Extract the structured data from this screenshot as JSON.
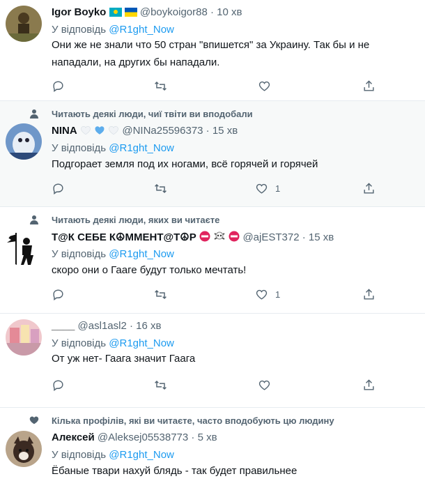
{
  "tweets": [
    {
      "name": "Igor Boyko",
      "handle": "@boykoigor88",
      "time": "10 хв",
      "reply_prefix": "У відповідь",
      "reply_to": "@R1ght_Now",
      "text": "Они же не знали что 50 стран \"впишется\" за Украину. Так бы и не нападали, на других бы нападали.",
      "likes": ""
    },
    {
      "social": "Читають деякі люди, чиї твіти ви вподобали",
      "name": "NINA",
      "handle": "@NINa25596373",
      "time": "15 хв",
      "reply_prefix": "У відповідь",
      "reply_to": "@R1ght_Now",
      "text": "Подгорает земля под их ногами, всё горячей и горячей",
      "likes": "1"
    },
    {
      "social": "Читають деякі люди, яких ви читаєте",
      "name": "Т@К СЕБЕ К☮ММЕНТ@Т☮Р",
      "handle": "@ajEST372",
      "time": "15 хв",
      "reply_prefix": "У відповідь",
      "reply_to": "@R1ght_Now",
      "text": "скоро они о Гааге будут только мечтать!",
      "likes": "1"
    },
    {
      "name": "____",
      "handle": "@asl1asl2",
      "time": "16 хв",
      "reply_prefix": "У відповідь",
      "reply_to": "@R1ght_Now",
      "text": "От уж нет- Гаага значит Гаага",
      "likes": ""
    },
    {
      "social": "Кількa профілів, які ви читаєте, часто вподобують цю людину",
      "name": "Алексей",
      "handle": "@Aleksej05538773",
      "time": "5 хв",
      "reply_prefix": "У відповідь",
      "reply_to": "@R1ght_Now",
      "text": "Ёбаные твари нахуй блядь - так будет правильнее",
      "likes": ""
    }
  ],
  "dot": "·",
  "colors": {
    "accent": "#1d9bf0",
    "muted": "#536471",
    "highlight_bg": "#f7f9f9"
  }
}
